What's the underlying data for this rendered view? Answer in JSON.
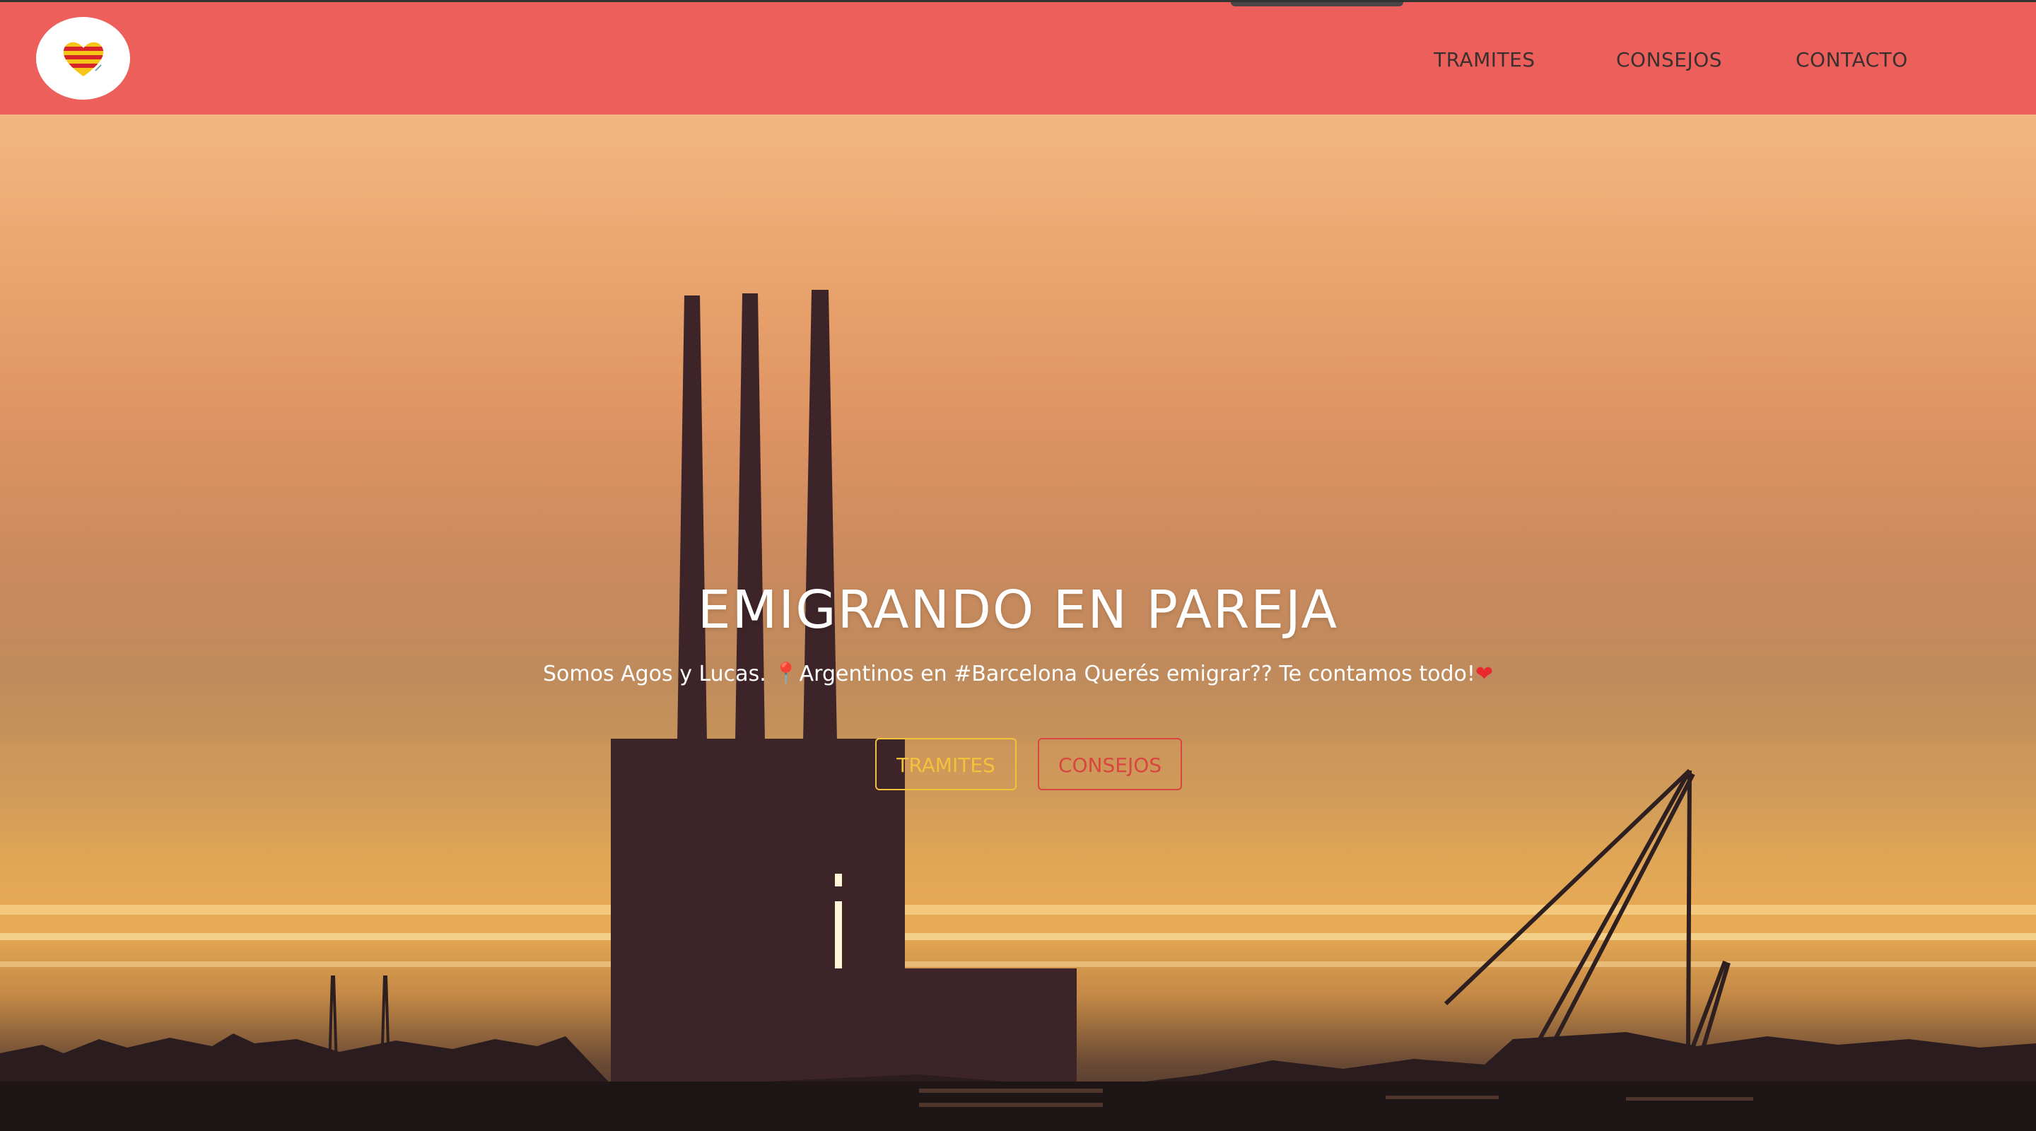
{
  "navbar": {
    "logo_icon": "heart-catalan-flag-logo",
    "links": [
      {
        "label": "TRAMITES"
      },
      {
        "label": "CONSEJOS"
      },
      {
        "label": "CONTACTO"
      }
    ],
    "background": "#ed5f5a"
  },
  "hero": {
    "title": "EMIGRANDO EN PAREJA",
    "subtitle_part1": "Somos Agos y Lucas. ",
    "subtitle_pin": "📍",
    "subtitle_part2": "Argentinos en #Barcelona Querés emigrar?? Te contamos todo!",
    "subtitle_heart": "❤",
    "buttons": [
      {
        "label": "TRAMITES",
        "color": "#f2c23a"
      },
      {
        "label": "CONSEJOS",
        "color": "#d9453f"
      }
    ],
    "background_video": "sunset-skyline-with-three-chimneys"
  }
}
